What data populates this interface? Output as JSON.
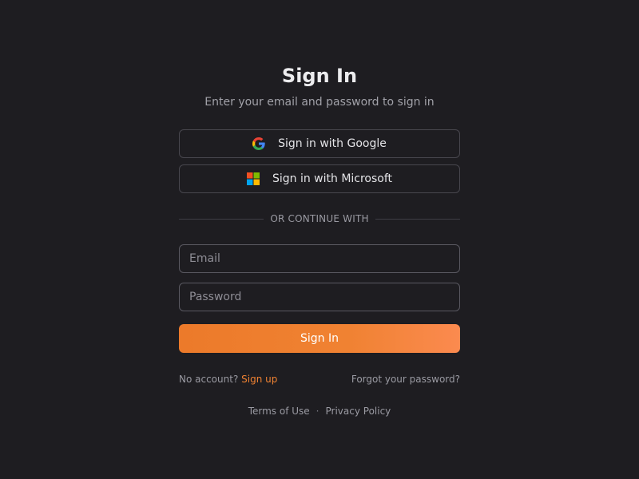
{
  "header": {
    "title": "Sign In",
    "subtitle": "Enter your email and password to sign in"
  },
  "oauth": {
    "google_label": "Sign in with Google",
    "microsoft_label": "Sign in with Microsoft",
    "google_icon": "google-g-icon",
    "microsoft_icon": "microsoft-logo-icon"
  },
  "divider": {
    "text": "OR CONTINUE WITH"
  },
  "form": {
    "email_placeholder": "Email",
    "email_value": "",
    "password_placeholder": "Password",
    "password_value": "",
    "submit_label": "Sign In"
  },
  "links": {
    "no_account_text": "No account?",
    "signup_label": "Sign up",
    "forgot_label": "Forgot your password?"
  },
  "footer": {
    "terms_label": "Terms of Use",
    "separator": "·",
    "privacy_label": "Privacy Policy"
  },
  "colors": {
    "background": "#1e1d21",
    "accent": "#f08232",
    "accent_gradient_end": "#fb8a4f",
    "border": "#48474e",
    "text_primary": "#ececee",
    "text_muted": "#9a9aa2"
  }
}
